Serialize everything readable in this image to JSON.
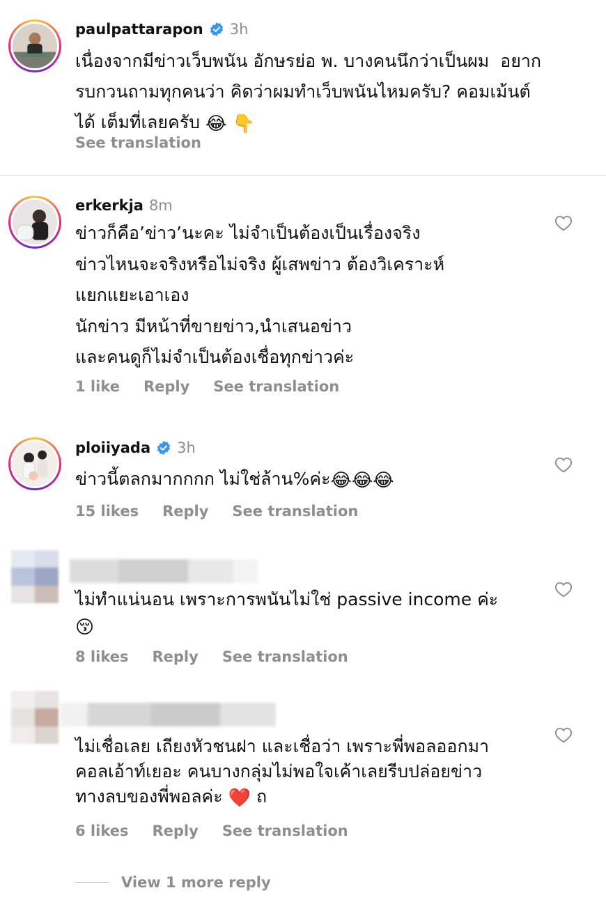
{
  "caption": {
    "username": "paulpattarapon",
    "time": "3h",
    "text": "เนื่องจากมีข่าวเว็บพนัน อักษรย่อ พ. บางคนนึกว่าเป็นผม  อยาก\nรบกวนถามทุกคนว่า คิดว่าผมทำเว็บพนันไหมครับ? คอมเม้นต์\nได้ เต็มที่เลยครับ ",
    "emoji": "😂 👇",
    "see_translation": "See translation"
  },
  "comments": [
    {
      "username": "erkerkja",
      "time": "8m",
      "text": "ข่าวก็คือ’ข่าว’นะคะ ไม่จำเป็นต้องเป็นเรื่องจริง\nข่าวไหนจะจริงหรือไม่จริง ผู้เสพข่าว ต้องวิเคราะห์\nแยกแยะเอาเอง\nนักข่าว มีหน้าที่ขายข่าว,นำเสนอข่าว\nและคนดูก็ไม่จำเป็นต้องเชื่อทุกข่าวค่ะ",
      "likes": "1 like",
      "reply": "Reply",
      "see_translation": "See translation"
    },
    {
      "username": "ploiiyada",
      "time": "3h",
      "text": "ข่าวนี้ตลกมากกกก ไม่ใช่ล้าน%ค่ะ",
      "emoji": "😂😂😂",
      "likes": "15 likes",
      "reply": "Reply",
      "see_translation": "See translation"
    },
    {
      "text": "ไม่ทำแน่นอน เพราะการพนันไม่ใช่ passive income ค่ะ\n",
      "emoji": "😚",
      "likes": "8 likes",
      "reply": "Reply",
      "see_translation": "See translation"
    },
    {
      "text": "ไม่เชื่อเลย เถียงหัวชนฝา และเชื่อว่า เพราะพี่พอลออกมา\nคอลเอ้าท์เยอะ คนบางกลุ่มไม่พอใจเค้าเลยรีบปล่อยข่าว\nทางลบของพี่พอลค่ะ ",
      "emoji": "❤️",
      "suffix": " ถ",
      "likes": "6 likes",
      "reply": "Reply",
      "see_translation": "See translation"
    }
  ],
  "view_more": "View 1 more reply",
  "colors": {
    "muted": "#8e8e8e",
    "verified": "#3897f0",
    "heart_like": "#ff3040"
  }
}
